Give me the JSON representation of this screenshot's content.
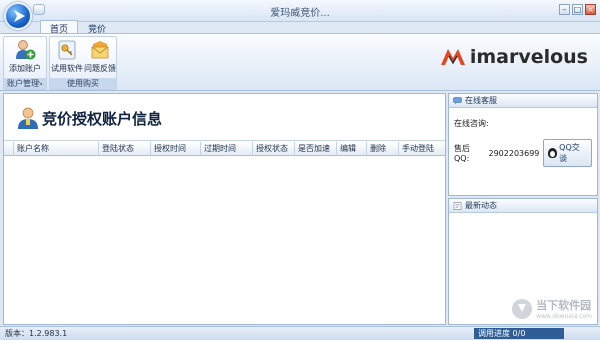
{
  "window": {
    "title": "爱玛威竞价...",
    "controls": [
      "minimize",
      "maximize",
      "close"
    ]
  },
  "tabs": [
    {
      "label": "首页",
      "active": true
    },
    {
      "label": "竞价",
      "active": false
    }
  ],
  "ribbon": {
    "groups": [
      {
        "label": "账户管理",
        "buttons": [
          {
            "label": "添加账户",
            "icon": "add-user-icon"
          }
        ]
      },
      {
        "label": "使用购买",
        "buttons": [
          {
            "label": "试用软件",
            "icon": "key-icon"
          },
          {
            "label": "问题反馈",
            "icon": "feedback-mail-icon"
          }
        ]
      }
    ]
  },
  "brand": {
    "logo_text": "imarvelous",
    "accent": "#e4471f"
  },
  "main": {
    "title": "竞价授权账户信息",
    "columns": [
      "账户名称",
      "登陆状态",
      "授权时间",
      "过期时间",
      "授权状态",
      "是否加速",
      "编辑",
      "删除",
      "手动登陆"
    ],
    "rows": []
  },
  "online_service": {
    "header": "在线客服",
    "consult_label": "在线咨询:",
    "qq_label": "售后QQ:",
    "qq_number": "2902203699",
    "qq_button": "QQ交谈"
  },
  "news": {
    "header": "最新动态"
  },
  "status": {
    "version": "版本：1.2.983.1",
    "progress": "调用进度 0/0"
  },
  "watermark": {
    "text": "当下软件园",
    "sub": "www.downxia.com"
  }
}
